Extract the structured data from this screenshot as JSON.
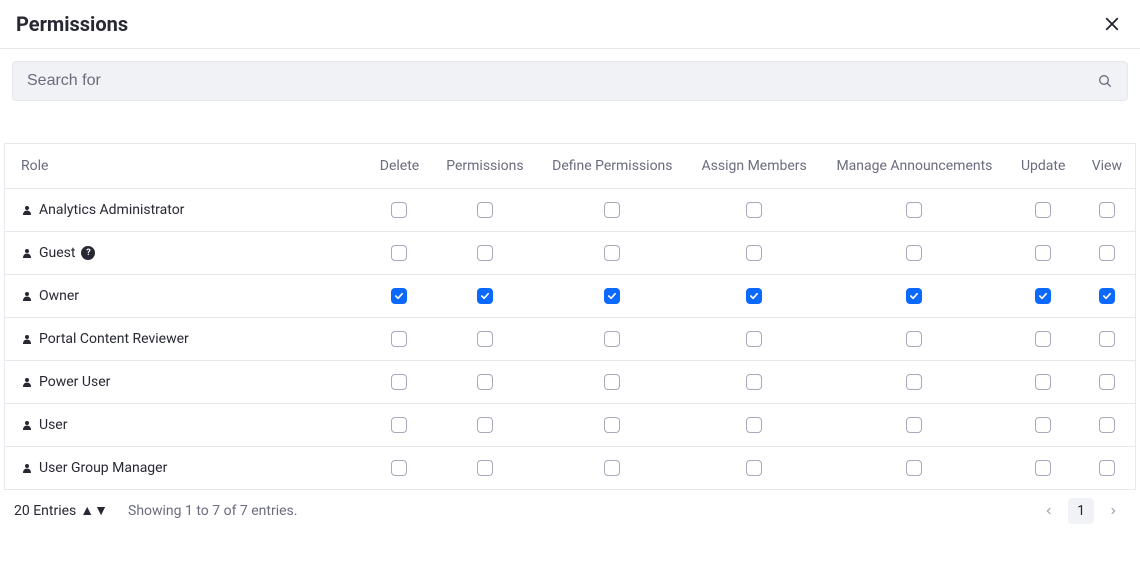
{
  "header": {
    "title": "Permissions"
  },
  "search": {
    "placeholder": "Search for"
  },
  "table": {
    "columns": [
      "Role",
      "Delete",
      "Permissions",
      "Define Permissions",
      "Assign Members",
      "Manage Announcements",
      "Update",
      "View"
    ],
    "rows": [
      {
        "name": "Analytics Administrator",
        "help": false,
        "perms": [
          false,
          false,
          false,
          false,
          false,
          false,
          false
        ]
      },
      {
        "name": "Guest",
        "help": true,
        "perms": [
          false,
          false,
          false,
          false,
          false,
          false,
          false
        ]
      },
      {
        "name": "Owner",
        "help": false,
        "perms": [
          true,
          true,
          true,
          true,
          true,
          true,
          true
        ]
      },
      {
        "name": "Portal Content Reviewer",
        "help": false,
        "perms": [
          false,
          false,
          false,
          false,
          false,
          false,
          false
        ]
      },
      {
        "name": "Power User",
        "help": false,
        "perms": [
          false,
          false,
          false,
          false,
          false,
          false,
          false
        ]
      },
      {
        "name": "User",
        "help": false,
        "perms": [
          false,
          false,
          false,
          false,
          false,
          false,
          false
        ]
      },
      {
        "name": "User Group Manager",
        "help": false,
        "perms": [
          false,
          false,
          false,
          false,
          false,
          false,
          false
        ]
      }
    ]
  },
  "footer": {
    "entries_label": "20 Entries",
    "showing": "Showing 1 to 7 of 7 entries.",
    "current_page": "1"
  }
}
